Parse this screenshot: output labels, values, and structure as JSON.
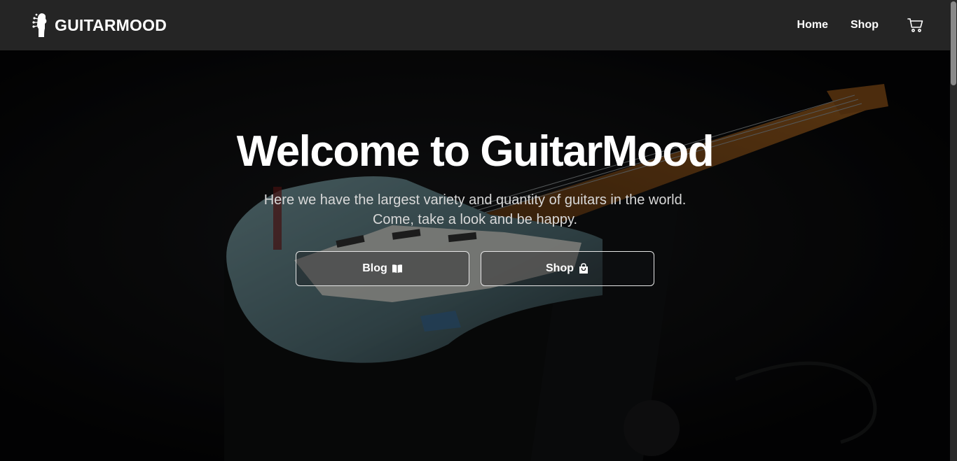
{
  "brand": {
    "name": "GUITARMOOD",
    "logo_icon": "guitar-headstock-icon"
  },
  "nav": {
    "links": [
      {
        "label": "Home"
      },
      {
        "label": "Shop"
      }
    ],
    "cart_icon": "cart-icon"
  },
  "hero": {
    "title": "Welcome to GuitarMood",
    "subtitle_lines": [
      "Here we have the largest variety and quantity of guitars in the world.",
      "Come, take a look and be happy."
    ],
    "buttons": [
      {
        "label": "Blog",
        "icon": "book-open-icon"
      },
      {
        "label": "Shop",
        "icon": "shopping-bag-icon"
      }
    ]
  },
  "colors": {
    "navbar_bg": "#252525",
    "hero_bg": "#070708",
    "text": "#ffffff",
    "subtitle": "#d8d8d8",
    "guitar_body": "#9fc3c8",
    "neck": "#b66a1e"
  }
}
